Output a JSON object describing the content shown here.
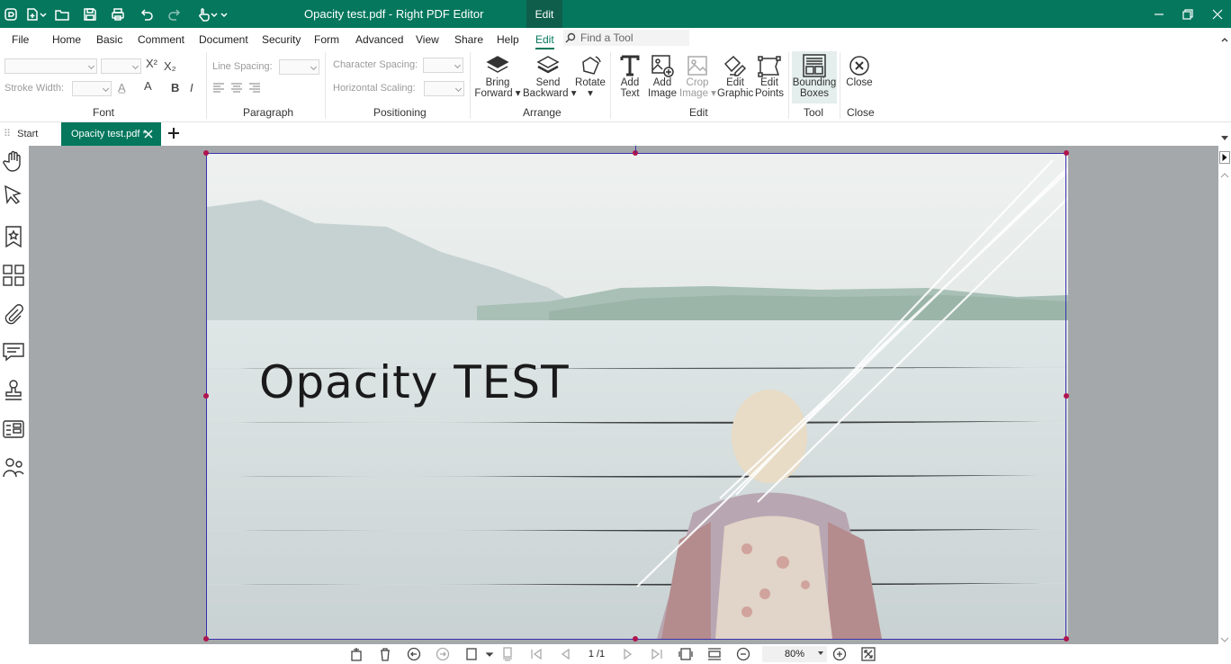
{
  "window": {
    "title": "Opacity test.pdf - Right PDF Editor",
    "context_tab": "Edit",
    "accent": "#04775d"
  },
  "menu": {
    "items": [
      "File",
      "Home",
      "Basic",
      "Comment",
      "Document",
      "Security",
      "Form",
      "Advanced",
      "View",
      "Share",
      "Help",
      "Edit"
    ],
    "active": "Edit",
    "find_placeholder": "Find a Tool"
  },
  "ribbon": {
    "font": {
      "label": "Font",
      "stroke_width_label": "Stroke Width:"
    },
    "paragraph": {
      "label": "Paragraph",
      "line_spacing_label": "Line Spacing:"
    },
    "positioning": {
      "label": "Positioning",
      "character_spacing_label": "Character Spacing:",
      "horizontal_scaling_label": "Horizontal Scaling:"
    },
    "arrange": {
      "label": "Arrange",
      "bring_forward": [
        "Bring",
        "Forward"
      ],
      "send_backward": [
        "Send",
        "Backward"
      ],
      "rotate": "Rotate"
    },
    "edit": {
      "label": "Edit",
      "add_text": [
        "Add",
        "Text"
      ],
      "add_image": [
        "Add",
        "Image"
      ],
      "crop_image": [
        "Crop",
        "Image"
      ],
      "edit_graphic": [
        "Edit",
        "Graphic"
      ],
      "edit_points": [
        "Edit",
        "Points"
      ]
    },
    "tool": {
      "label": "Tool",
      "bounding_boxes": [
        "Bounding",
        "Boxes"
      ]
    },
    "close": {
      "label": "Close",
      "close_button": "Close"
    }
  },
  "tabs": {
    "start": "Start",
    "document": "Opacity test.pdf *"
  },
  "document": {
    "heading": "Opacity TEST"
  },
  "status": {
    "page_indicator": "1 /1",
    "zoom": "80%"
  },
  "icons": [
    "app-logo-icon",
    "new-doc-icon",
    "open-folder-icon",
    "save-icon",
    "print-icon",
    "undo-icon",
    "redo-icon",
    "touch-mode-icon",
    "hand-tool-icon",
    "select-tool-icon",
    "bookmark-icon",
    "thumbnails-icon",
    "attachment-icon",
    "comments-icon",
    "stamp-icon",
    "form-fields-icon",
    "signatures-icon"
  ]
}
